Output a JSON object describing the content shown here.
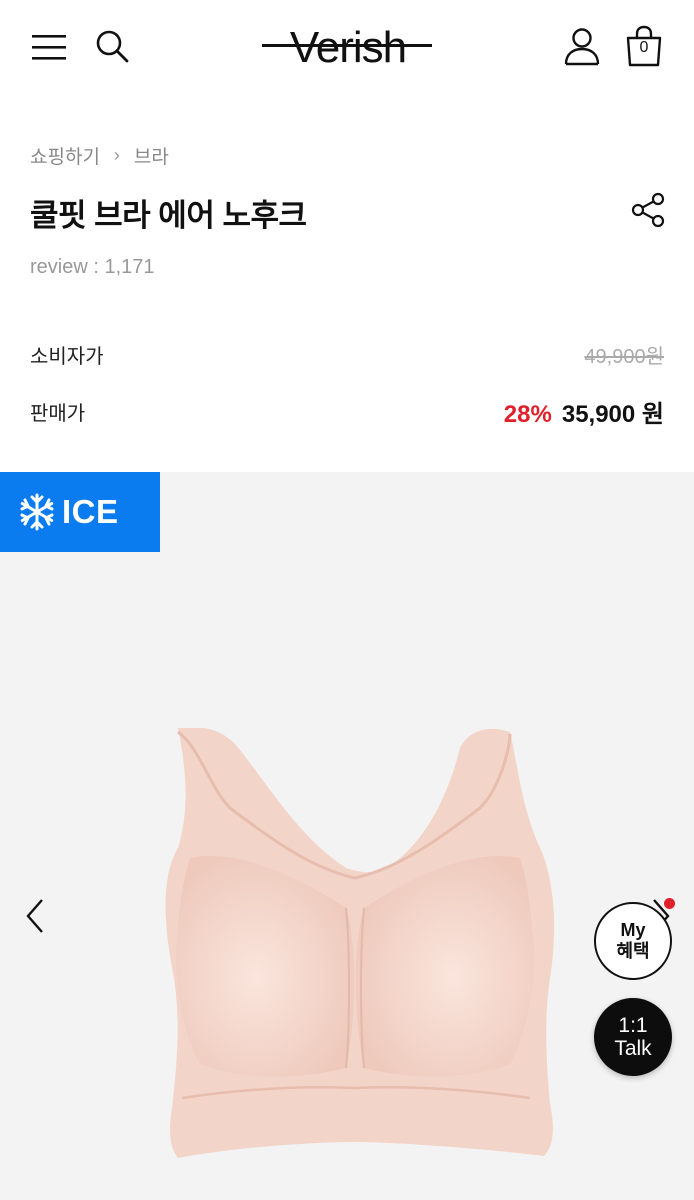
{
  "header": {
    "logo": "Verish",
    "cart_count": "0"
  },
  "breadcrumb": {
    "items": [
      "쇼핑하기",
      "브라"
    ],
    "separator": "›"
  },
  "product": {
    "title": "쿨핏 브라 에어 노후크",
    "review": "review : 1,171",
    "consumer_price_label": "소비자가",
    "consumer_price": "49,900원",
    "sale_price_label": "판매가",
    "discount": "28%",
    "sale_price": "35,900 원"
  },
  "gallery": {
    "badge": "ICE"
  },
  "floating": {
    "my_line1": "My",
    "my_line2": "혜택",
    "talk_line1": "1:1",
    "talk_line2": "Talk"
  },
  "colors": {
    "accent_blue": "#0a7cf0",
    "discount_red": "#e0202a",
    "image_bg": "#f3f3f3",
    "product_tone": "#f6dcd2"
  }
}
